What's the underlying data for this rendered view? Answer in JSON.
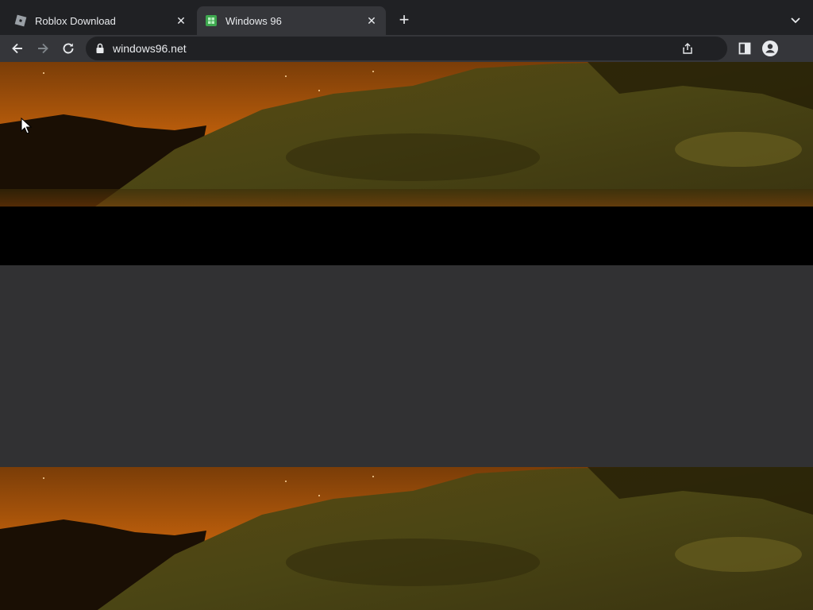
{
  "browser": {
    "tabs": [
      {
        "title": "Roblox Download",
        "icon": "roblox-icon",
        "active": false
      },
      {
        "title": "Windows 96",
        "icon": "windows96-icon",
        "active": true
      }
    ],
    "address": "windows96.net"
  },
  "colors": {
    "tabstrip": "#202124",
    "toolbar": "#35363a",
    "omnibox": "#202124",
    "text": "#e8eaed",
    "page_gray": "#313133",
    "sky_top": "#7a3d08",
    "sky_glow": "#c8640c",
    "hill": "#4a4514"
  }
}
